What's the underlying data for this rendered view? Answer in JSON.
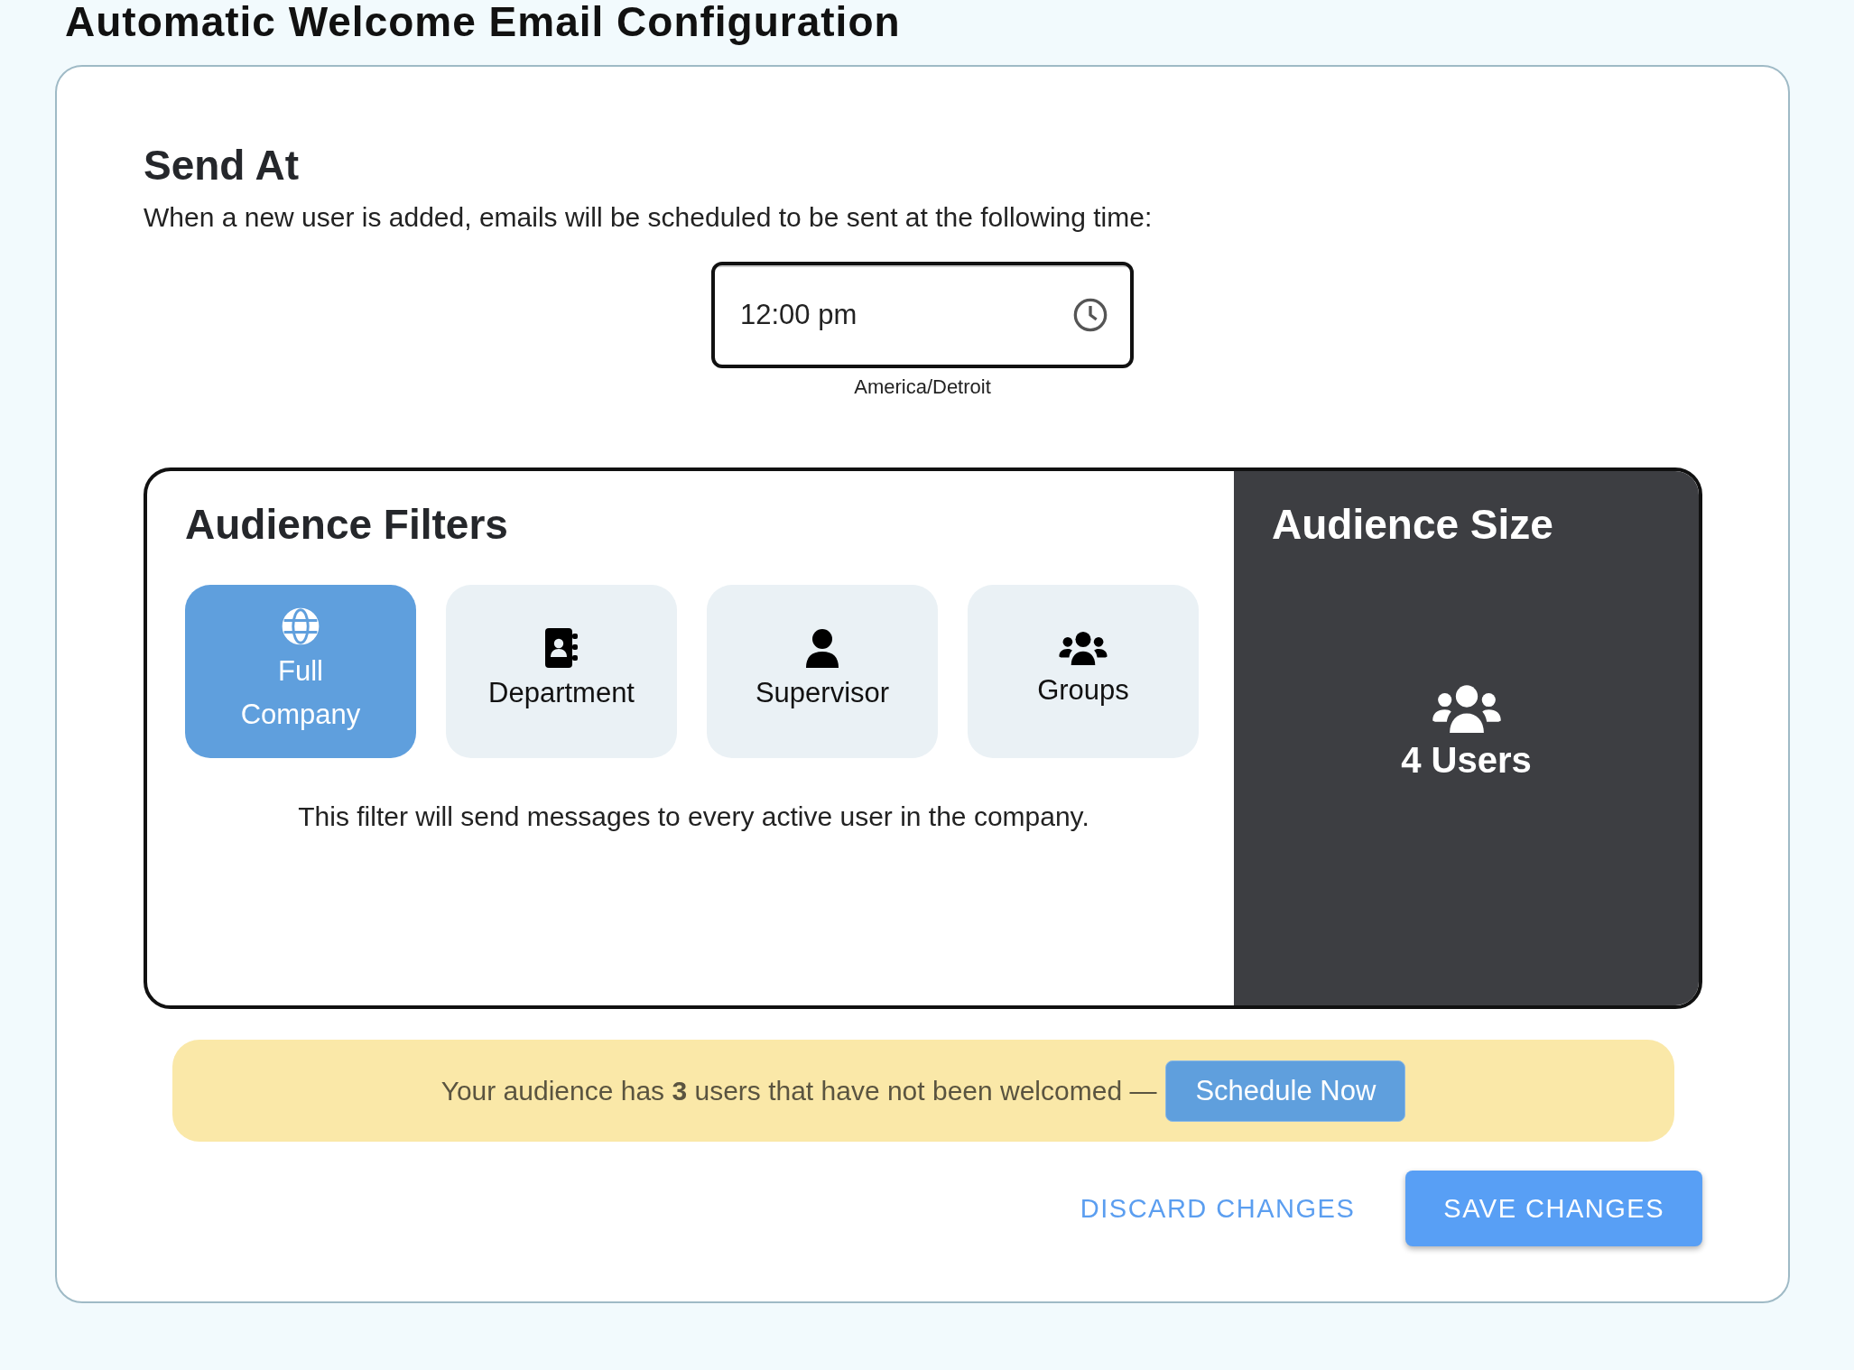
{
  "page_title": "Automatic Welcome Email Configuration",
  "send_at": {
    "heading": "Send At",
    "description": "When a new user is added, emails will be scheduled to be sent at the following time:",
    "time_field": {
      "value": "12:00 pm"
    },
    "timezone": "America/Detroit"
  },
  "audience_filters": {
    "heading": "Audience Filters",
    "filters": [
      {
        "label": "Full Company",
        "kind": "globe",
        "selected": true
      },
      {
        "label": "Department",
        "kind": "contacts",
        "selected": false
      },
      {
        "label": "Supervisor",
        "kind": "person",
        "selected": false
      },
      {
        "label": "Groups",
        "kind": "people",
        "selected": false
      }
    ],
    "description": "This filter will send messages to every active user in the company."
  },
  "audience_size": {
    "heading": "Audience Size",
    "count": "4 Users"
  },
  "notice": {
    "text": "Your audience has **3** users that have not been welcomed —",
    "button": "Schedule Now"
  },
  "actions": [
    {
      "label": "DISCARD CHANGES",
      "kind": "text"
    },
    {
      "label": "SAVE CHANGES",
      "kind": "contained"
    }
  ]
}
